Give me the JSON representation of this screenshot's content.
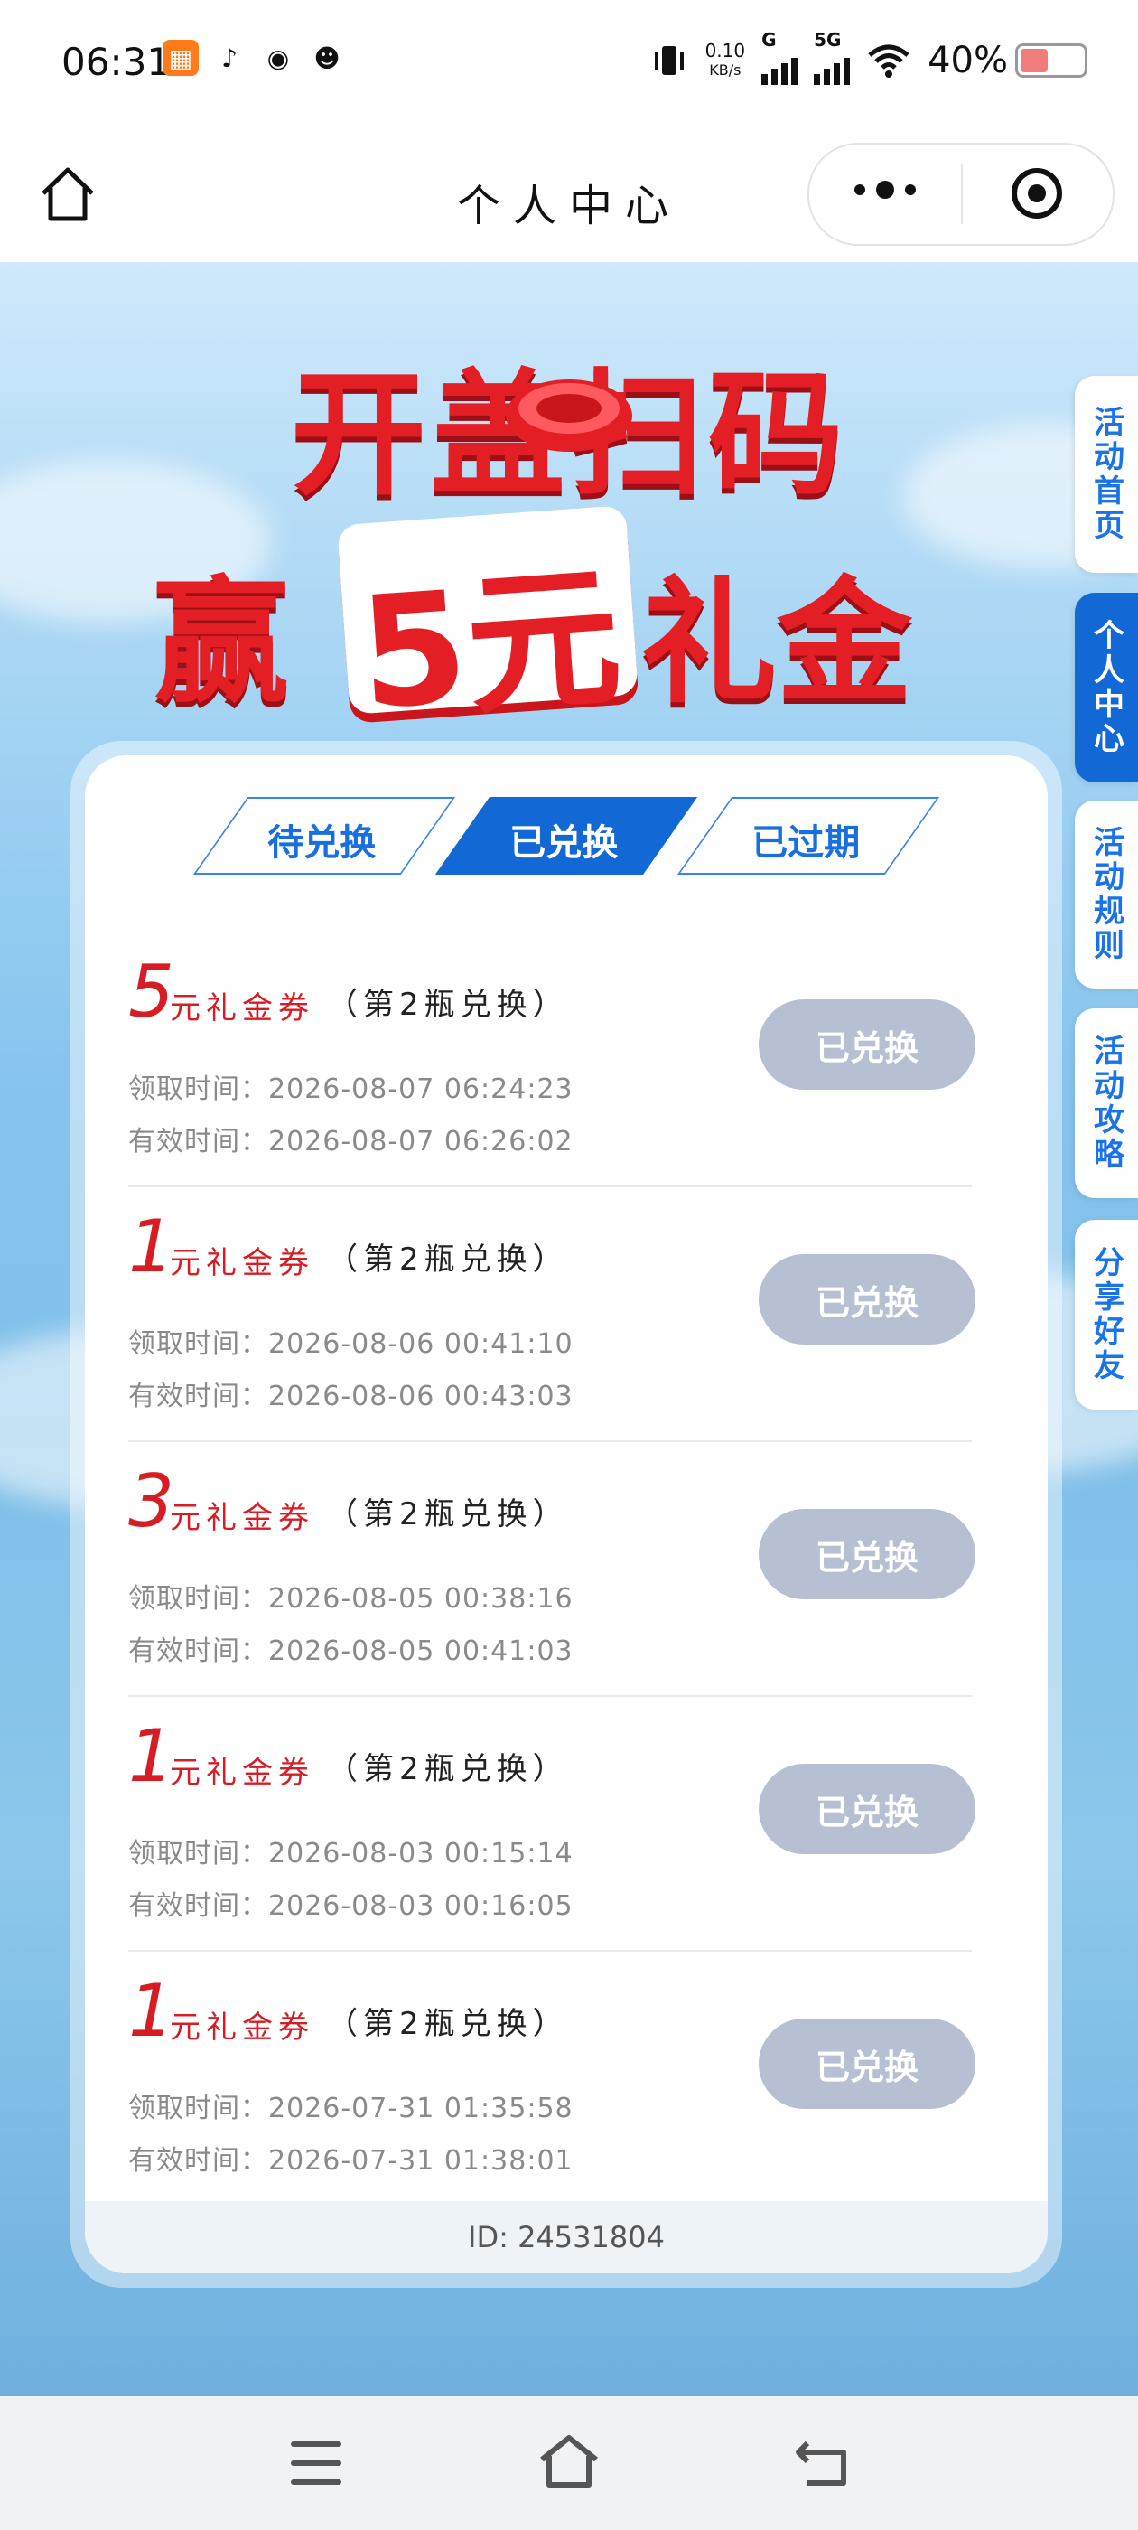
{
  "status_bar": {
    "time": "06:31",
    "net_speed": "0.10",
    "net_unit": "KB/s",
    "sig1_label": "G",
    "sig2_label": "5G",
    "battery": "40%",
    "app_icons": [
      "pinduoduo-icon",
      "tiktok-icon",
      "wechat-icon",
      "qq-icon"
    ]
  },
  "nav": {
    "title": "个人中心"
  },
  "banner": {
    "line1": "开盖扫码",
    "line2_prefix": "赢",
    "line2_highlight": "5元",
    "line2_suffix": "礼金"
  },
  "sidebar": {
    "items": [
      {
        "label": "活动首页",
        "active": false
      },
      {
        "label": "个人中心",
        "active": true
      },
      {
        "label": "活动规则",
        "active": false
      },
      {
        "label": "活动攻略",
        "active": false
      },
      {
        "label": "分享好友",
        "active": false
      }
    ]
  },
  "tabs": [
    {
      "label": "待兑换",
      "active": false
    },
    {
      "label": "已兑换",
      "active": true
    },
    {
      "label": "已过期",
      "active": false
    }
  ],
  "coupons": [
    {
      "amount": "5",
      "unit": "元礼金券",
      "note": "（第2瓶兑换）",
      "received": "领取时间：2026-08-07 06:24:23",
      "valid": "有效时间：2026-08-07 06:26:02",
      "button": "已兑换"
    },
    {
      "amount": "1",
      "unit": "元礼金券",
      "note": "（第2瓶兑换）",
      "received": "领取时间：2026-08-06 00:41:10",
      "valid": "有效时间：2026-08-06 00:43:03",
      "button": "已兑换"
    },
    {
      "amount": "3",
      "unit": "元礼金券",
      "note": "（第2瓶兑换）",
      "received": "领取时间：2026-08-05 00:38:16",
      "valid": "有效时间：2026-08-05 00:41:03",
      "button": "已兑换"
    },
    {
      "amount": "1",
      "unit": "元礼金券",
      "note": "（第2瓶兑换）",
      "received": "领取时间：2026-08-03 00:15:14",
      "valid": "有效时间：2026-08-03 00:16:05",
      "button": "已兑换"
    },
    {
      "amount": "1",
      "unit": "元礼金券",
      "note": "（第2瓶兑换）",
      "received": "领取时间：2026-07-31 01:35:58",
      "valid": "有效时间：2026-07-31 01:38:01",
      "button": "已兑换"
    }
  ],
  "user_id": "ID: 24531804",
  "colors": {
    "accent": "#1269d6",
    "red": "#d71d24",
    "button_disabled": "#b7c0d2"
  }
}
